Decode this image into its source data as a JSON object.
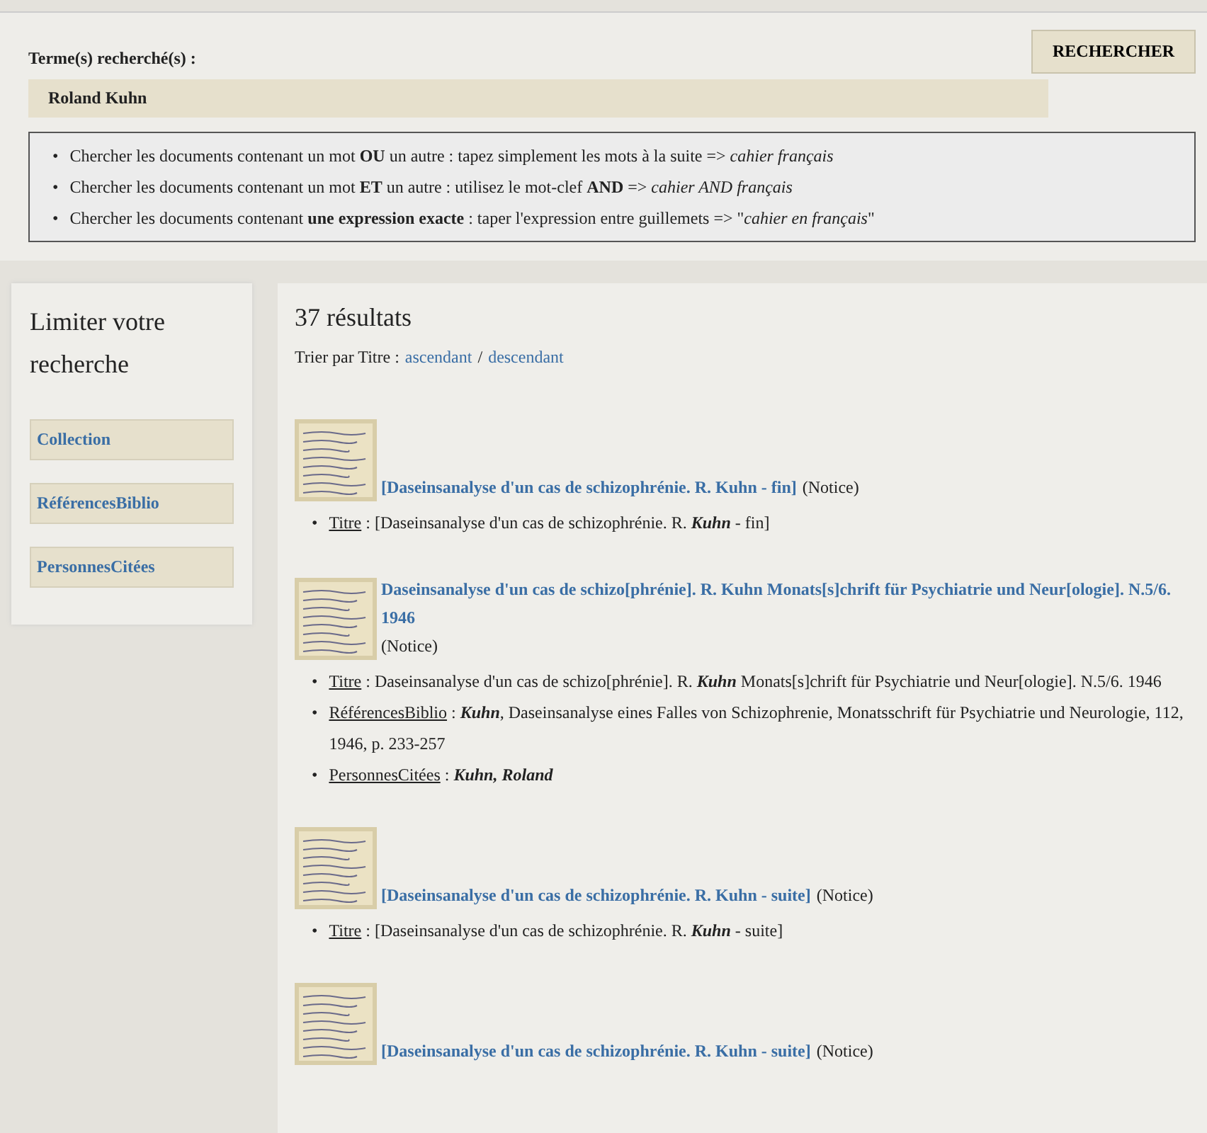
{
  "search": {
    "label": "Terme(s) recherché(s) :",
    "value": "Roland Kuhn",
    "button": "RECHERCHER",
    "marker": "•",
    "tips": [
      "Chercher les documents contenant un mot **OU** un autre : tapez simplement les mots à la suite => *cahier français*",
      "Chercher les documents contenant un mot **ET** un autre : utilisez le mot-clef **AND** => *cahier AND français*",
      "Chercher les documents contenant **une expression exacte** : taper l'expression entre guillemets => \"*cahier en français*\""
    ]
  },
  "sidebar": {
    "title": "Limiter votre recherche",
    "facets": [
      "Collection",
      "RéférencesBiblio",
      "PersonnesCitées"
    ]
  },
  "results": {
    "count": "37 résultats",
    "sort_label": "Trier par Titre :",
    "sort_links": [
      "ascendant",
      "descendant"
    ],
    "sort_separator": "/",
    "marker": "•",
    "items": [
      {
        "title": "[Daseinsanalyse d'un cas de schizophrénie. R. Kuhn - fin]",
        "type": "(Notice)",
        "fields": [
          {
            "label": "Titre",
            "value": ": [Daseinsanalyse d'un cas de schizophrénie. R. **Kuhn** - fin]"
          }
        ]
      },
      {
        "title": "Daseinsanalyse d'un cas de schizo[phrénie]. R. Kuhn Monats[s]chrift für Psychiatrie und Neur[ologie]. N.5/6. 1946",
        "type": "(Notice)",
        "fields": [
          {
            "label": "Titre",
            "value": ": Daseinsanalyse d'un cas de schizo[phrénie]. R. **Kuhn** Monats[s]chrift für Psychiatrie und Neur[ologie]. N.5/6. 1946"
          },
          {
            "label": "RéférencesBiblio",
            "value": ": **Kuhn**, Daseinsanalyse eines Falles von Schizophrenie, Monatsschrift für Psychiatrie und Neurologie, 112, 1946, p. 233-257"
          },
          {
            "label": "PersonnesCitées",
            "value": ": **Kuhn, Roland**"
          }
        ]
      },
      {
        "title": "[Daseinsanalyse d'un cas de schizophrénie. R. Kuhn - suite]",
        "type": "(Notice)",
        "fields": [
          {
            "label": "Titre",
            "value": ": [Daseinsanalyse d'un cas de schizophrénie. R. **Kuhn** - suite]"
          }
        ]
      },
      {
        "title": "[Daseinsanalyse d'un cas de schizophrénie. R. Kuhn - suite]",
        "type": "(Notice)"
      }
    ]
  }
}
